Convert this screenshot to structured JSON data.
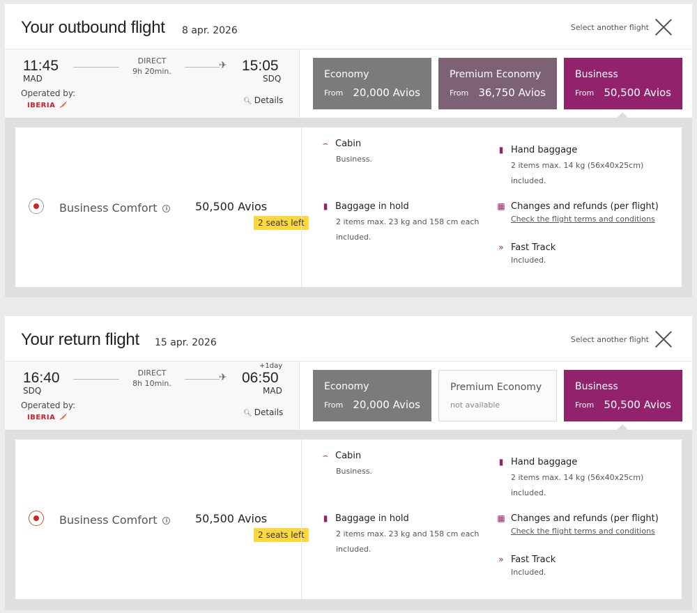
{
  "flights": [
    {
      "title": "Your outbound flight",
      "date": "8 apr.",
      "year": "2026",
      "select_another": "Select another flight",
      "dep_time": "11:45",
      "dep_code": "MAD",
      "arr_time": "15:05",
      "arr_code": "SDQ",
      "plus_day": "",
      "direct": "DIRECT",
      "duration": "9h 20min.",
      "operated_by": "Operated by:",
      "airline": "IBERIA",
      "details": "Details",
      "fares": {
        "economy": {
          "name": "Economy",
          "from": "From",
          "price": "20,000 Avios"
        },
        "premium": {
          "name": "Premium Economy",
          "from": "From",
          "price": "36,750 Avios",
          "status": ""
        },
        "business": {
          "name": "Business",
          "from": "From",
          "price": "50,500 Avios"
        }
      },
      "class_name": "Business Comfort",
      "class_price": "50,500 Avios",
      "seats_left": "2 seats left",
      "features": {
        "cabin": {
          "label": "Cabin",
          "value": "Business."
        },
        "hand": {
          "label": "Hand baggage",
          "value1": "2 items max. 14 kg (56x40x25cm)",
          "value2": "included."
        },
        "hold": {
          "label": "Baggage in hold",
          "value1": "2 items max. 23 kg and 158 cm each",
          "value2": "included."
        },
        "changes": {
          "label": "Changes and refunds (per flight)",
          "link": "Check the flight terms and conditions"
        },
        "fast": {
          "label": "Fast Track",
          "value": "Included."
        }
      }
    },
    {
      "title": "Your return flight",
      "date": "15 apr.",
      "year": "2026",
      "select_another": "Select another flight",
      "dep_time": "16:40",
      "dep_code": "SDQ",
      "arr_time": "06:50",
      "arr_code": "MAD",
      "plus_day": "+1day",
      "direct": "DIRECT",
      "duration": "8h 10min.",
      "operated_by": "Operated by:",
      "airline": "IBERIA",
      "details": "Details",
      "fares": {
        "economy": {
          "name": "Economy",
          "from": "From",
          "price": "20,000 Avios"
        },
        "premium": {
          "name": "Premium Economy",
          "from": "",
          "price": "",
          "status": "not available"
        },
        "business": {
          "name": "Business",
          "from": "From",
          "price": "50,500 Avios"
        }
      },
      "class_name": "Business Comfort",
      "class_price": "50,500 Avios",
      "seats_left": "2 seats left",
      "features": {
        "cabin": {
          "label": "Cabin",
          "value": "Business."
        },
        "hand": {
          "label": "Hand baggage",
          "value1": "2 items max. 14 kg (56x40x25cm)",
          "value2": "included."
        },
        "hold": {
          "label": "Baggage in hold",
          "value1": "2 items max. 23 kg and 158 cm each",
          "value2": "included."
        },
        "changes": {
          "label": "Changes and refunds (per flight)",
          "link": "Check the flight terms and conditions"
        },
        "fast": {
          "label": "Fast Track",
          "value": "Included."
        }
      }
    }
  ],
  "colors": {
    "economy": "#7b7b7b",
    "premium": "#7d6175",
    "business": "#93226c",
    "seats_badge": "#fcd83d",
    "iberia_red": "#d7192d"
  },
  "icons": {
    "plane": "plane-icon",
    "close": "close-icon",
    "search": "search-icon",
    "info": "info-icon",
    "cabin": "seat-icon",
    "hand": "hand-baggage-icon",
    "hold": "suitcase-icon",
    "changes": "calendar-icon",
    "fast": "fast-track-icon"
  }
}
